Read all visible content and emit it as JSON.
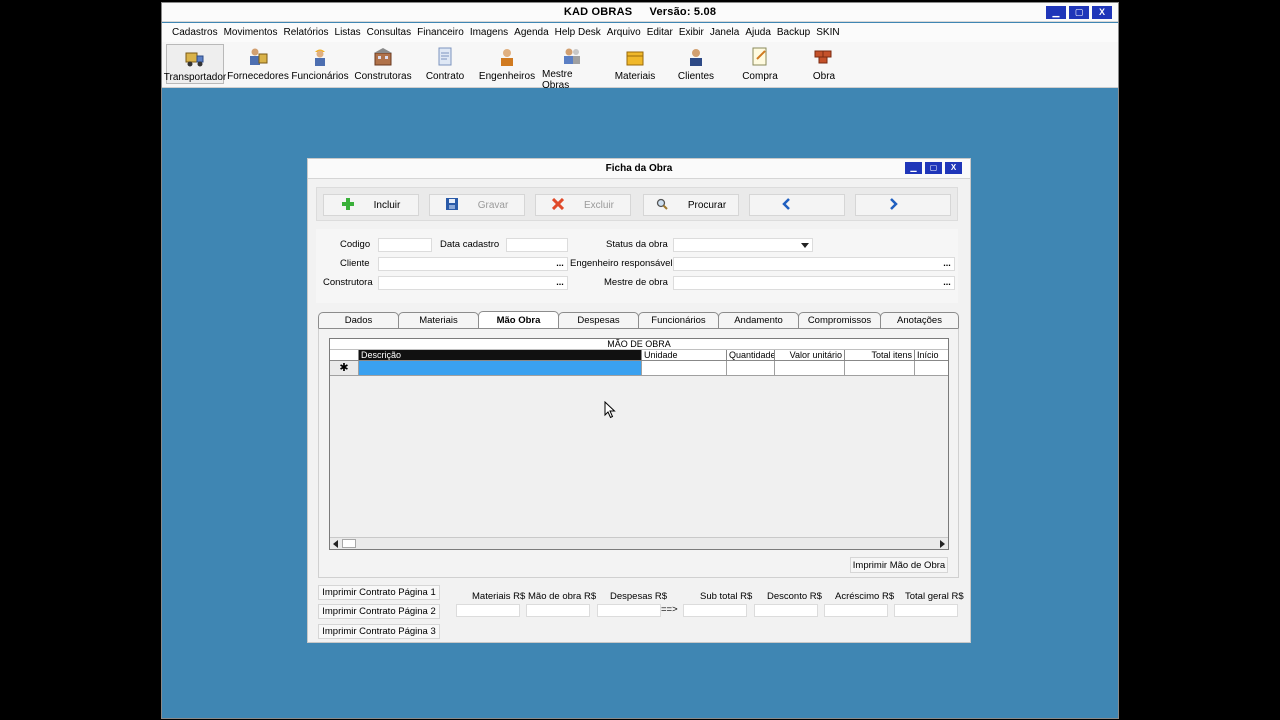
{
  "app": {
    "title": "KAD OBRAS",
    "version": "Versão: 5.08",
    "win_buttons": [
      "▁",
      "▢",
      "X"
    ]
  },
  "menu": [
    "Cadastros",
    "Movimentos",
    "Relatórios",
    "Listas",
    "Consultas",
    "Financeiro",
    "Imagens",
    "Agenda",
    "Help Desk",
    "Arquivo",
    "Editar",
    "Exibir",
    "Janela",
    "Ajuda",
    "Backup",
    "SKIN"
  ],
  "toolbar": [
    {
      "label": "Transportador",
      "icon": "truck-icon"
    },
    {
      "label": "Fornecedores",
      "icon": "suppliers-icon"
    },
    {
      "label": "Funcionários",
      "icon": "worker-icon"
    },
    {
      "label": "Construtoras",
      "icon": "building-icon"
    },
    {
      "label": "Contrato",
      "icon": "contract-icon"
    },
    {
      "label": "Engenheiros",
      "icon": "engineer-icon"
    },
    {
      "label": "Mestre Obras",
      "icon": "foreman-icon"
    },
    {
      "label": "Materiais",
      "icon": "box-icon"
    },
    {
      "label": "Clientes",
      "icon": "client-icon"
    },
    {
      "label": "Compra",
      "icon": "purchase-icon"
    },
    {
      "label": "Obra",
      "icon": "bricks-icon"
    }
  ],
  "window": {
    "title": "Ficha da Obra",
    "actions": [
      {
        "label": "Incluir",
        "icon": "plus-icon",
        "disabled": false
      },
      {
        "label": "Gravar",
        "icon": "save-icon",
        "disabled": true
      },
      {
        "label": "Excluir",
        "icon": "delete-icon",
        "disabled": true
      },
      {
        "label": "Procurar",
        "icon": "search-icon",
        "disabled": false
      },
      {
        "label": "",
        "icon": "chevron-left-icon",
        "disabled": false
      },
      {
        "label": "",
        "icon": "chevron-right-icon",
        "disabled": false
      }
    ],
    "form": {
      "codigo_label": "Codigo",
      "codigo_value": "",
      "data_cadastro_label": "Data cadastro",
      "data_cadastro_value": "",
      "status_label": "Status da obra",
      "status_value": "",
      "cliente_label": "Cliente",
      "cliente_value": "",
      "engenheiro_label": "Engenheiro responsável",
      "engenheiro_value": "",
      "construtora_label": "Construtora",
      "construtora_value": "",
      "mestre_label": "Mestre de obra",
      "mestre_value": "",
      "lookup_glyph": "..."
    },
    "tabs": [
      "Dados",
      "Materiais",
      "Mão Obra",
      "Despesas",
      "Funcionários",
      "Andamento",
      "Compromissos",
      "Anotações"
    ],
    "active_tab": "Mão Obra",
    "grid": {
      "caption": "MÃO DE OBRA",
      "columns": [
        "Descrição",
        "Unidade",
        "Quantidade",
        "Valor unitário",
        "Total itens",
        "Início"
      ],
      "new_row_marker": "✱"
    },
    "print_labor_button": "Imprimir Mão de Obra",
    "print_buttons": [
      "Imprimir Contrato Página 1",
      "Imprimir Contrato Página 2",
      "Imprimir Contrato Página 3"
    ],
    "totals": {
      "labels": [
        "Materiais R$",
        "Mão de obra R$",
        "Despesas R$",
        "Sub total R$",
        "Desconto R$",
        "Acréscimo R$",
        "Total geral R$"
      ],
      "arrow": "==>"
    }
  },
  "colors": {
    "desktop": "#3f86b3",
    "titlebar_button": "#1f36b9",
    "selection": "#3aa1f0"
  }
}
